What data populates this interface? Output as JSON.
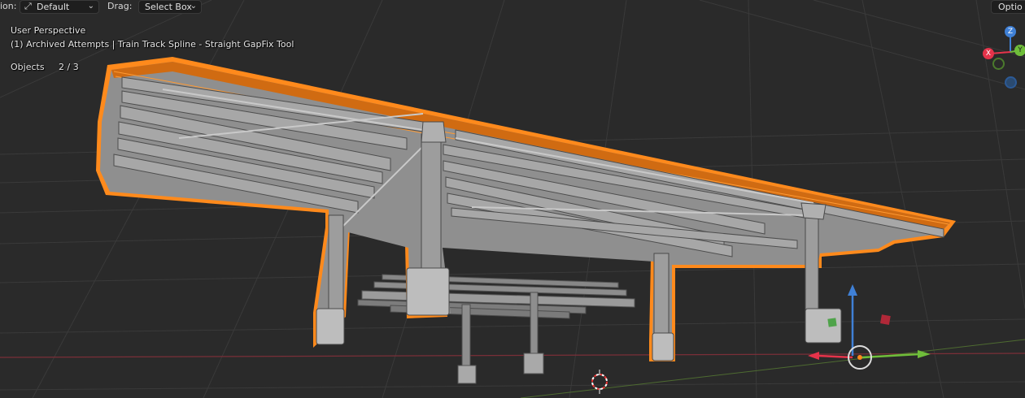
{
  "header": {
    "orientation_label": "ion:",
    "orientation_value": "Default",
    "drag_label": "Drag:",
    "drag_value": "Select Box",
    "options_label": "Optio"
  },
  "overlay": {
    "view_name": "User Perspective",
    "collection_line": "(1) Archived Attempts | Train Track Spline - Straight GapFix Tool",
    "objects_label": "Objects",
    "objects_count": "2 / 3"
  },
  "nav_gizmo": {
    "axis_z": "Z",
    "axis_x": "X",
    "axis_y": "Y"
  },
  "colors": {
    "selection_outline": "#ff8a1c",
    "axis_x": "#e5334a",
    "axis_y": "#6fbe3a",
    "axis_z": "#3f80d6",
    "background": "#2a2a2a"
  }
}
